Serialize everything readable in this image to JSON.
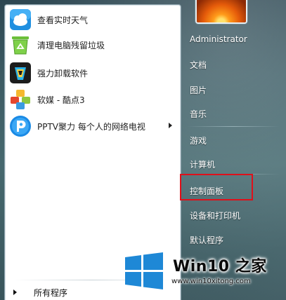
{
  "programs": [
    {
      "label": "查看实时天气",
      "icon": "weather-icon"
    },
    {
      "label": "清理电脑残留垃圾",
      "icon": "recycle-bin-icon"
    },
    {
      "label": "强力卸载软件",
      "icon": "uninstaller-icon"
    },
    {
      "label": "软媒 - 酷点3",
      "icon": "cubes-icon"
    },
    {
      "label": "PPTV聚力 每个人的网络电视",
      "icon": "pptv-icon",
      "has_submenu": true
    }
  ],
  "all_programs_label": "所有程序",
  "right_links": {
    "user": "Administrator",
    "documents": "文档",
    "pictures": "图片",
    "music": "音乐",
    "games": "游戏",
    "computer": "计算机",
    "control_panel": "控制面板",
    "devices_printers": "设备和打印机",
    "default_programs": "默认程序"
  },
  "highlighted_item": "控制面板",
  "highlight_color": "#e0101a",
  "watermark": {
    "title": "Win10 之家",
    "url": "www.win10xitong.com",
    "logo_color": "#1e88d6"
  }
}
